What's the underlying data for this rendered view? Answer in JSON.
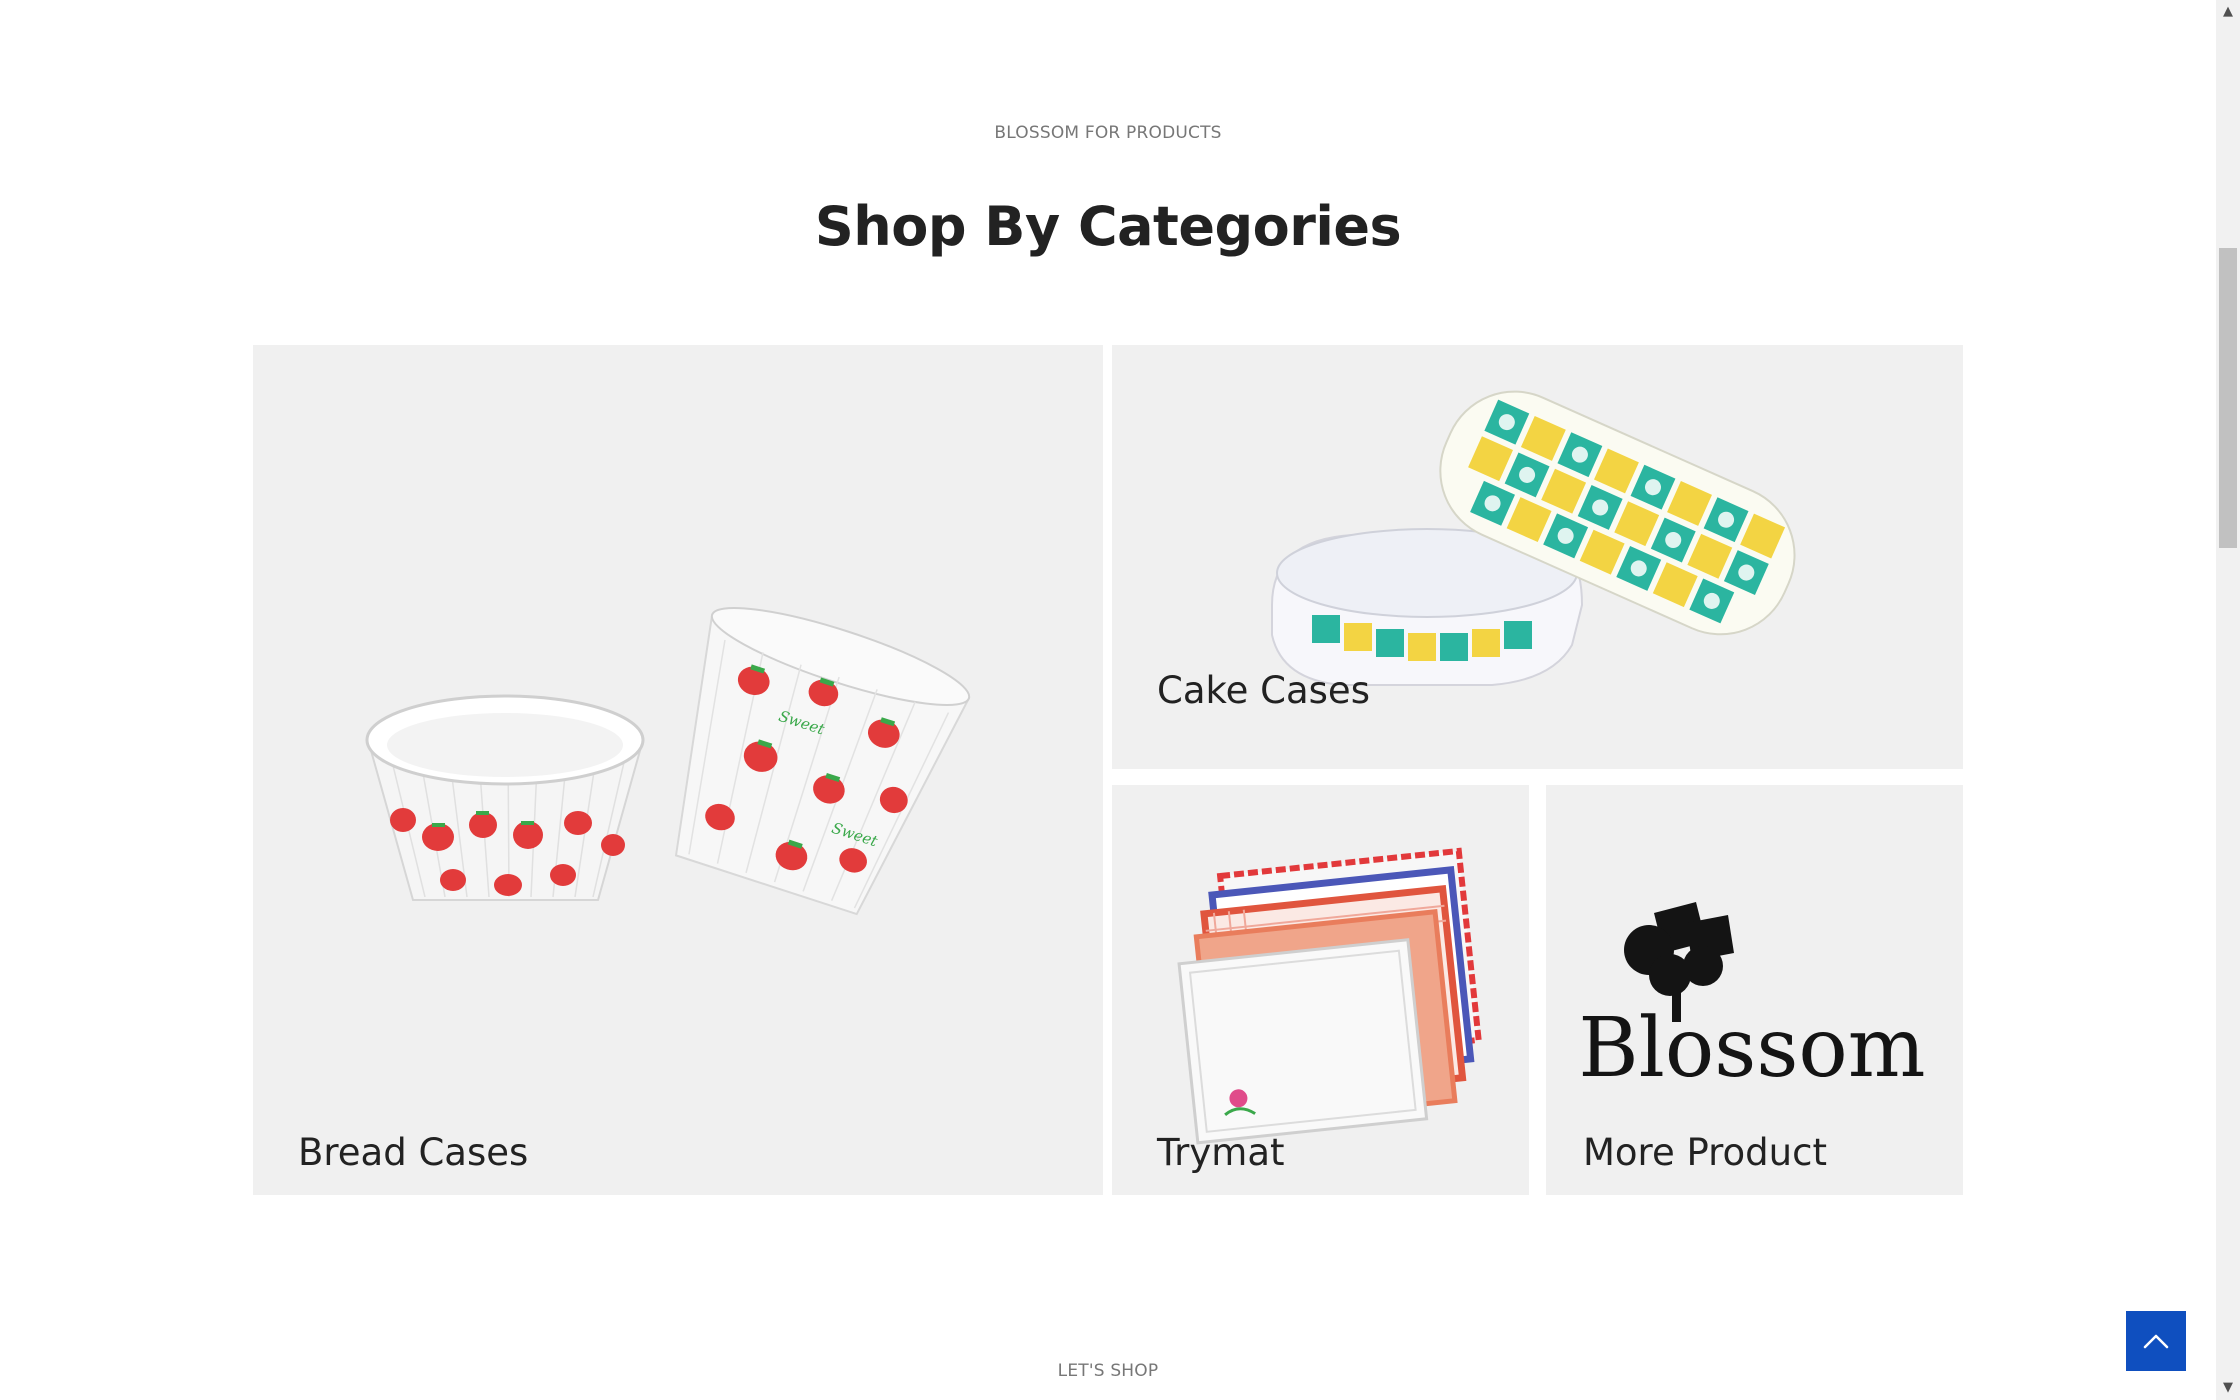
{
  "section": {
    "eyebrow": "BLOSSOM FOR PRODUCTS",
    "title": "Shop By Categories"
  },
  "categories": [
    {
      "label": "Bread Cases",
      "icon": "strawberry-paper-cups-image"
    },
    {
      "label": "Cake Cases",
      "icon": "floral-loaf-cases-image"
    },
    {
      "label": "Trymat",
      "icon": "tray-mats-image"
    },
    {
      "label": "More Product",
      "icon": "blossom-logo-image",
      "logo_text": "Blossom"
    }
  ],
  "next_section": {
    "eyebrow": "LET'S SHOP"
  },
  "controls": {
    "back_to_top_icon": "chevron-up-icon",
    "scroll_up_icon": "scroll-up-arrow-icon",
    "scroll_down_icon": "scroll-down-arrow-icon"
  },
  "colors": {
    "card_background": "#f0f0f0",
    "heading": "#222222",
    "eyebrow": "#777777",
    "back_to_top": "#0f4fbf",
    "strawberry_red": "#e23b3b",
    "accent_teal": "#2bb5a0",
    "accent_yellow": "#f3d443"
  }
}
